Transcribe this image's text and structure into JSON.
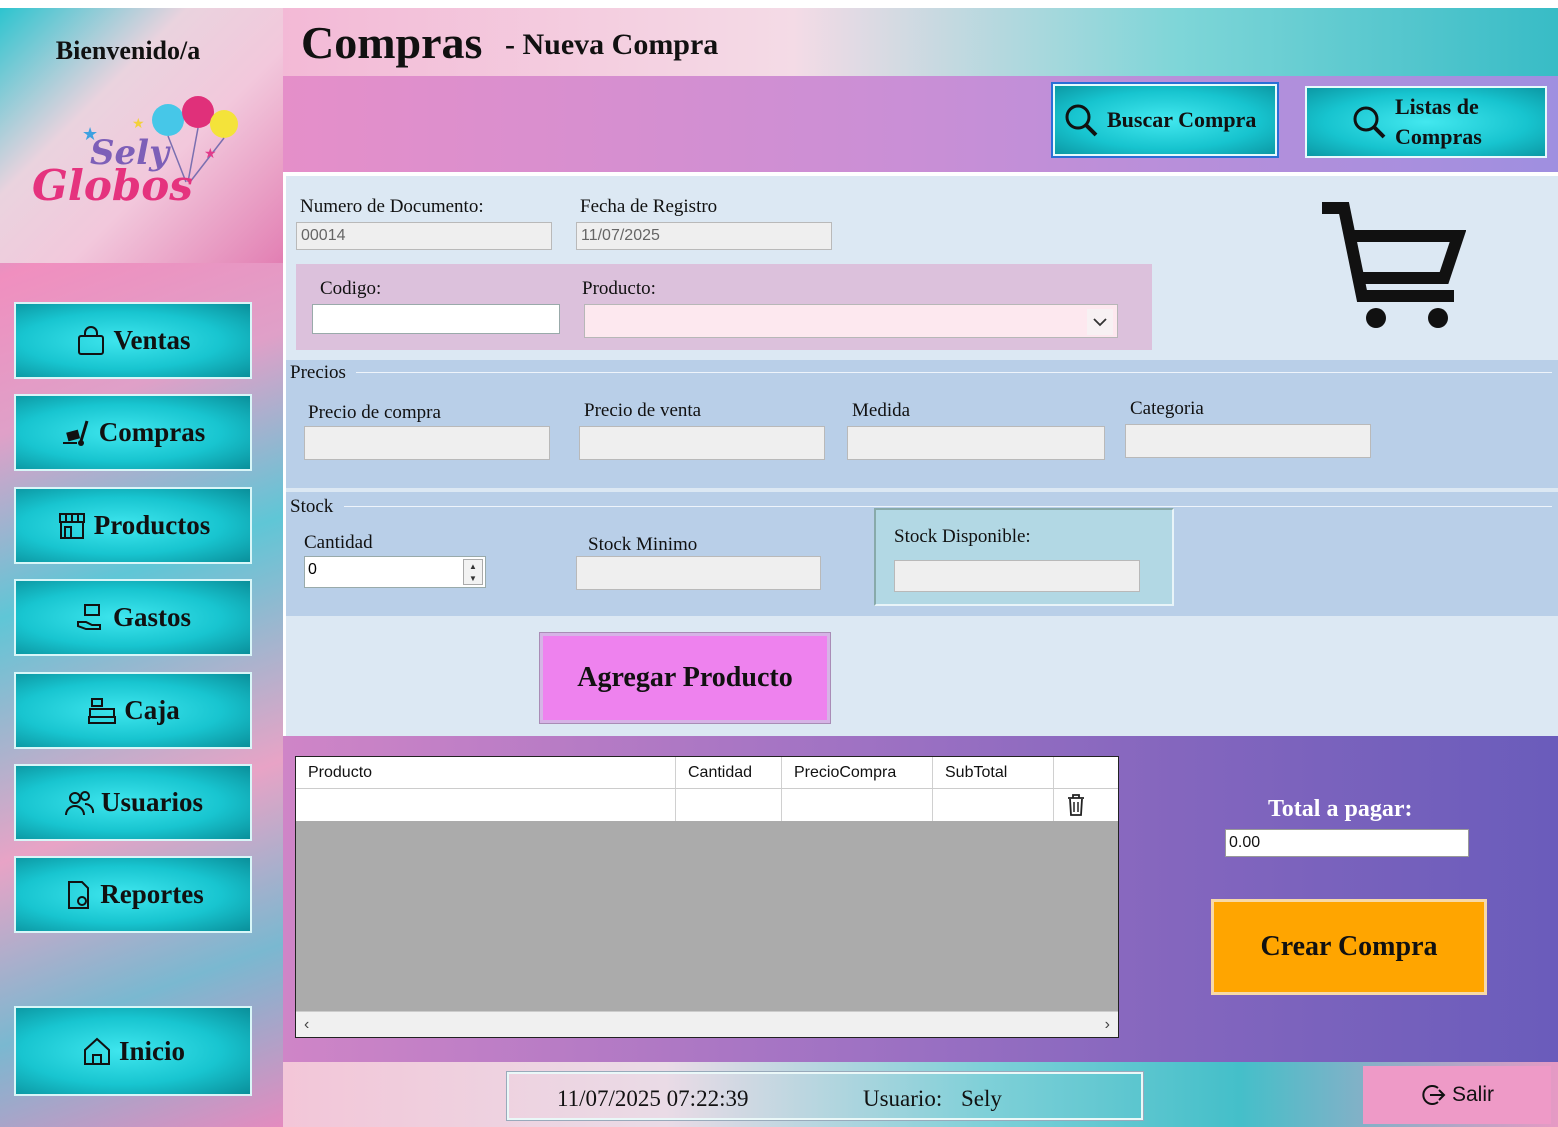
{
  "sidebar": {
    "welcome": "Bienvenido/a",
    "logo": {
      "line1": "Sely",
      "line2": "Globos"
    },
    "items": [
      {
        "label": "Ventas",
        "icon": "shopping-bag-icon"
      },
      {
        "label": "Compras",
        "icon": "hand-truck-icon"
      },
      {
        "label": "Productos",
        "icon": "store-icon"
      },
      {
        "label": "Gastos",
        "icon": "money-hand-icon"
      },
      {
        "label": "Caja",
        "icon": "cash-register-icon"
      },
      {
        "label": "Usuarios",
        "icon": "users-icon"
      },
      {
        "label": "Reportes",
        "icon": "report-icon"
      }
    ],
    "home": {
      "label": "Inicio",
      "icon": "home-icon"
    }
  },
  "header": {
    "title": "Compras",
    "subtitle": "- Nueva Compra"
  },
  "toolbar": {
    "search_label": "Buscar Compra",
    "list_label_1": "Listas de",
    "list_label_2": "Compras"
  },
  "form": {
    "doc_number_label": "Numero de Documento:",
    "doc_number_value": "00014",
    "date_label": "Fecha de Registro",
    "date_value": "11/07/2025",
    "code_label": "Codigo:",
    "code_value": "",
    "product_label": "Producto:",
    "product_value": "",
    "prices_group": "Precios",
    "purchase_price_label": "Precio de compra",
    "sale_price_label": "Precio de venta",
    "measure_label": "Medida",
    "category_label": "Categoria",
    "stock_group": "Stock",
    "quantity_label": "Cantidad",
    "quantity_value": "0",
    "min_stock_label": "Stock Minimo",
    "available_stock_label": "Stock Disponible:",
    "add_button": "Agregar Producto"
  },
  "table": {
    "columns": [
      "Producto",
      "Cantidad",
      "PrecioCompra",
      "SubTotal"
    ],
    "rows": [
      [
        "",
        "",
        "",
        ""
      ]
    ]
  },
  "summary": {
    "total_label": "Total a pagar:",
    "total_value": "0.00",
    "create_button": "Crear Compra"
  },
  "status": {
    "datetime": "11/07/2025 07:22:39",
    "user_label": "Usuario:",
    "user_value": "Sely",
    "exit_label": "Salir"
  },
  "colors": {
    "accent_button": "#18c5d0",
    "add_button": "#ee82ee",
    "create_button": "#ffa500"
  }
}
